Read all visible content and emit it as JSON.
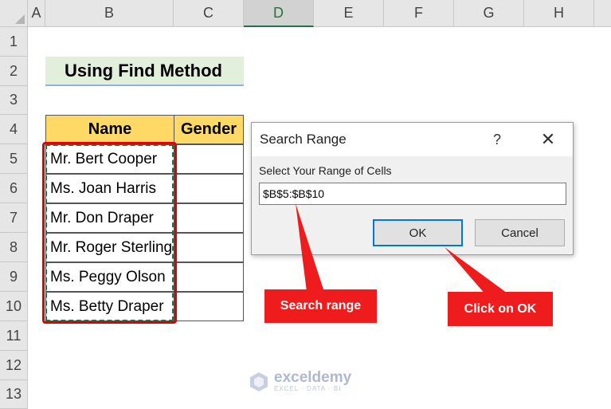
{
  "columns": [
    "A",
    "B",
    "C",
    "D",
    "E",
    "F",
    "G",
    "H"
  ],
  "selected_column": "D",
  "rows": [
    "1",
    "2",
    "3",
    "4",
    "5",
    "6",
    "7",
    "8",
    "9",
    "10",
    "11",
    "12",
    "13"
  ],
  "sheet": {
    "title": "Using Find Method",
    "table": {
      "headers": [
        "Name",
        "Gender"
      ],
      "names": [
        "Mr. Bert Cooper",
        "Ms. Joan Harris",
        "Mr. Don Draper",
        "Mr. Roger Sterling",
        "Ms. Peggy Olson",
        "Ms. Betty Draper"
      ],
      "genders": [
        "",
        "",
        "",
        "",
        "",
        ""
      ]
    }
  },
  "dialog": {
    "title": "Search Range",
    "help": "?",
    "close": "✕",
    "prompt": "Select Your Range of Cells",
    "input_value": "$B$5:$B$10",
    "ok_label": "OK",
    "cancel_label": "Cancel"
  },
  "annotations": {
    "search_range": "Search range",
    "click_ok": "Click on OK"
  },
  "watermark": {
    "name": "exceldemy",
    "tagline": "EXCEL · DATA · BI"
  },
  "colors": {
    "accent_red": "#ee1c1c",
    "header_yellow": "#ffd966",
    "title_green": "#e2efda",
    "excel_green": "#217346"
  }
}
